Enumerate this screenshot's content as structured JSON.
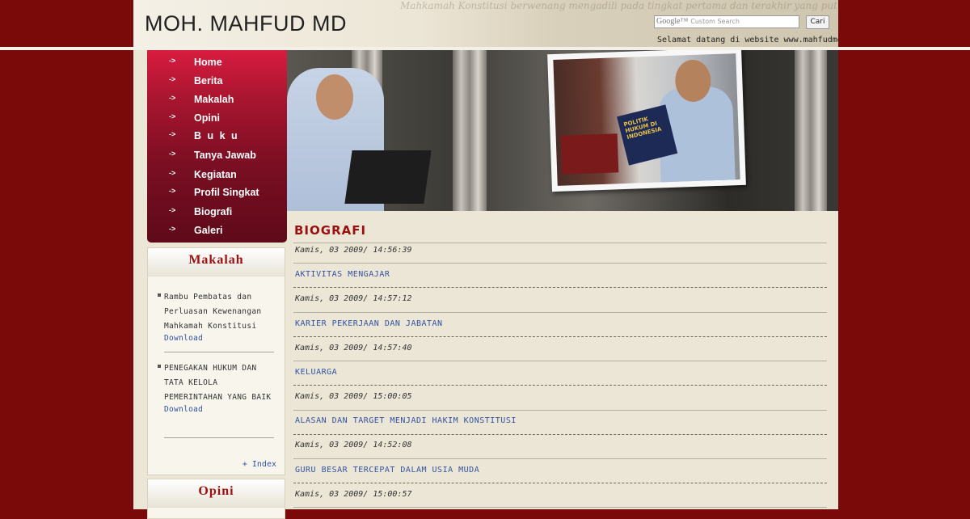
{
  "header": {
    "site_title": "MOH. MAHFUD MD",
    "search_placeholder": "Custom Search",
    "search_brand": "Google™",
    "search_button": "Cari",
    "welcome": "Selamat datang di website www.mahfudmd.com",
    "watermark_text": "Mahkamah Konstitusi berwenang mengadili pada tingkat pertama dan terakhir yang putusannya bersifat final untuk menguji undang-undang terhadap memutus sengketa kewenangan lembaga negara"
  },
  "nav": {
    "items": [
      {
        "label": "Home"
      },
      {
        "label": "Berita"
      },
      {
        "label": "Makalah"
      },
      {
        "label": "Opini"
      },
      {
        "label": "B u k u"
      },
      {
        "label": "Tanya Jawab"
      },
      {
        "label": "Kegiatan"
      },
      {
        "label": "Profil Singkat"
      },
      {
        "label": "Biografi"
      },
      {
        "label": "Galeri"
      }
    ],
    "arrow": "->"
  },
  "banner": {
    "book_title": "POLITIK HUKUM DI INDONESIA"
  },
  "sidebar": {
    "makalah": {
      "title": "Makalah",
      "items": [
        {
          "text": "Rambu Pembatas dan Perluasan Kewenangan Mahkamah Konstitusi",
          "download": "Download"
        },
        {
          "text": "PENEGAKAN HUKUM DAN TATA KELOLA PEMERINTAHAN YANG BAIK",
          "download": "Download"
        }
      ],
      "index_link": "+ Index"
    },
    "opini": {
      "title": "Opini"
    }
  },
  "content": {
    "title": "BIOGRAFI",
    "entries": [
      {
        "date": "Kamis, 03 2009/ 14:56:39",
        "title": "AKTIVITAS MENGAJAR"
      },
      {
        "date": "Kamis, 03 2009/ 14:57:12",
        "title": "KARIER PEKERJAAN DAN JABATAN"
      },
      {
        "date": "Kamis, 03 2009/ 14:57:40",
        "title": "KELUARGA"
      },
      {
        "date": "Kamis, 03 2009/ 15:00:05",
        "title": "ALASAN DAN TARGET MENJADI HAKIM KONSTITUSI"
      },
      {
        "date": "Kamis, 03 2009/ 14:52:08",
        "title": "GURU BESAR TERCEPAT DALAM USIA MUDA"
      },
      {
        "date": "Kamis, 03 2009/ 15:00:57",
        "title": ""
      }
    ]
  },
  "colors": {
    "background": "#7a0a0a",
    "accent": "#9a1010",
    "link": "#3352a3",
    "nav_top": "#d81c40",
    "nav_bottom": "#5e0a19"
  }
}
